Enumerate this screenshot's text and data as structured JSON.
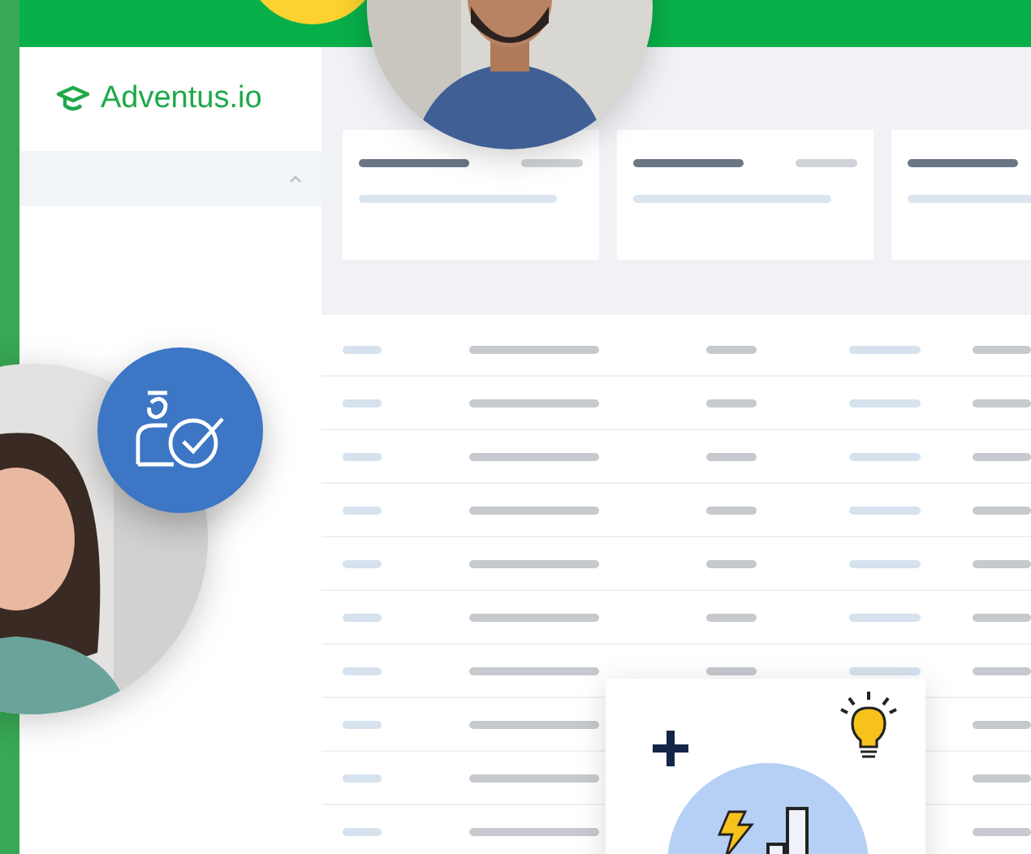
{
  "logo": {
    "text": "Adventus.io"
  },
  "sidebar": {
    "group_expanded": true
  },
  "stat_cards": [
    {
      "kind": "placeholder"
    },
    {
      "kind": "placeholder"
    },
    {
      "kind": "placeholder"
    }
  ],
  "table": {
    "rows": [
      {
        "kind": "placeholder"
      },
      {
        "kind": "placeholder"
      },
      {
        "kind": "placeholder"
      },
      {
        "kind": "placeholder"
      },
      {
        "kind": "placeholder"
      },
      {
        "kind": "placeholder"
      },
      {
        "kind": "placeholder"
      },
      {
        "kind": "placeholder"
      },
      {
        "kind": "placeholder"
      },
      {
        "kind": "placeholder"
      }
    ]
  }
}
